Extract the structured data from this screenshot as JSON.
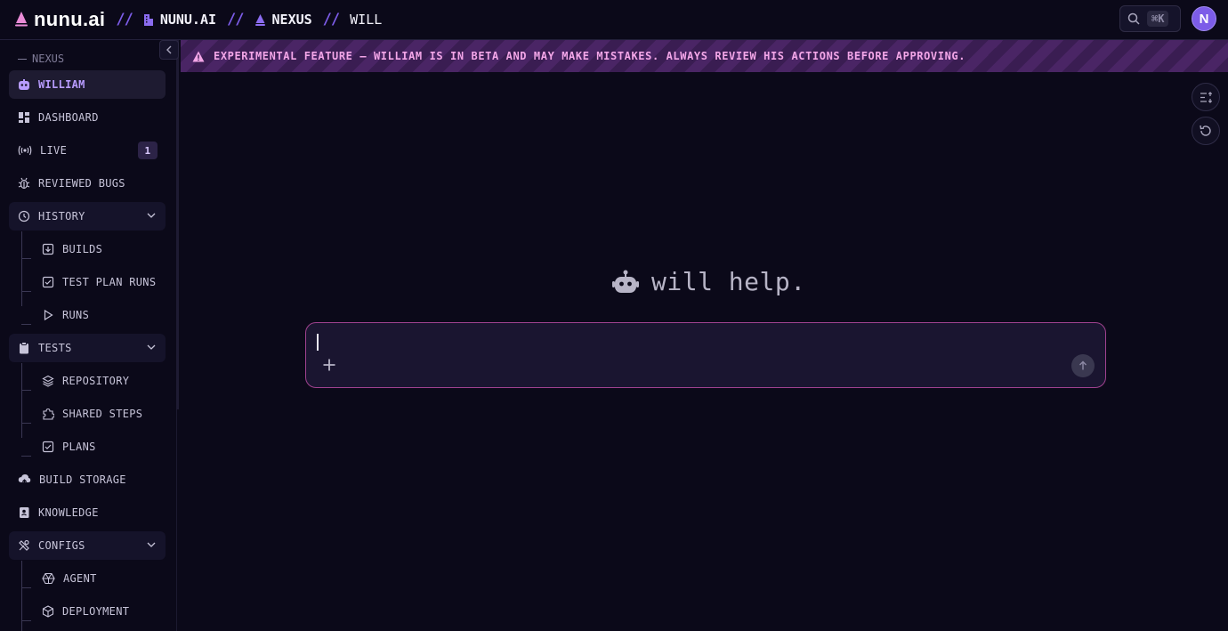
{
  "topbar": {
    "logo_text": "nunu.ai",
    "separator": "//",
    "breadcrumbs": [
      {
        "label": "NUNU.AI"
      },
      {
        "label": "NEXUS"
      },
      {
        "label": "WILL"
      }
    ],
    "search_shortcut": "⌘K",
    "avatar_initial": "N"
  },
  "sidebar": {
    "section_label": "NEXUS",
    "items": {
      "william": {
        "label": "WILLIAM"
      },
      "dashboard": {
        "label": "DASHBOARD"
      },
      "live": {
        "label": "LIVE",
        "badge": "1"
      },
      "reviewed_bugs": {
        "label": "REVIEWED BUGS"
      },
      "history": {
        "label": "HISTORY"
      },
      "builds": {
        "label": "BUILDS"
      },
      "test_plan_runs": {
        "label": "TEST PLAN RUNS"
      },
      "runs": {
        "label": "RUNS"
      },
      "tests": {
        "label": "TESTS"
      },
      "repository": {
        "label": "REPOSITORY"
      },
      "shared_steps": {
        "label": "SHARED STEPS"
      },
      "plans": {
        "label": "PLANS"
      },
      "build_storage": {
        "label": "BUILD STORAGE"
      },
      "knowledge": {
        "label": "KNOWLEDGE"
      },
      "configs": {
        "label": "CONFIGS"
      },
      "agent": {
        "label": "AGENT"
      },
      "deployment": {
        "label": "DEPLOYMENT"
      }
    }
  },
  "banner": {
    "text": "EXPERIMENTAL FEATURE — WILLIAM IS IN BETA AND MAY MAKE MISTAKES. ALWAYS REVIEW HIS ACTIONS BEFORE APPROVING."
  },
  "main": {
    "hero_text": "will help.",
    "composer": {
      "value": "",
      "placeholder": ""
    }
  },
  "colors": {
    "accent": "#7c5ce8",
    "banner_text": "#f3a6e8",
    "composer_border": "#a0428f",
    "background": "#0b0919"
  }
}
